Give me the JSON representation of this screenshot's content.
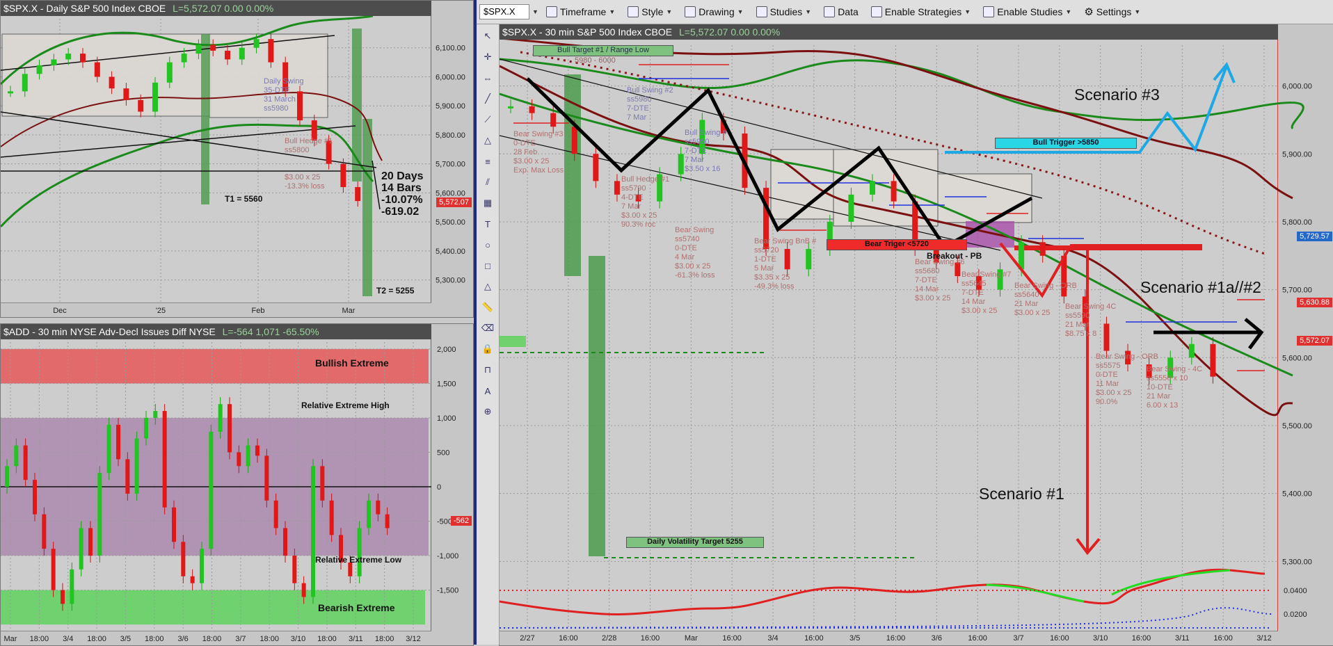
{
  "toolbar": {
    "symbol": "$SPX.X",
    "items": [
      "Timeframe",
      "Style",
      "Drawing",
      "Studies",
      "Data",
      "Enable Strategies",
      "Enable Studies",
      "Settings"
    ]
  },
  "daily": {
    "title": "$SPX.X - Daily  S&P 500 Index  CBOE",
    "last": "L=5,572.07  0.00  0.00%",
    "price_tag": "5,572.07",
    "stats": [
      "20 Days",
      "14 Bars",
      "-10.07%",
      "-619.02"
    ],
    "t1": "T1 = 5560",
    "t2": "T2 = 5255",
    "notes": {
      "daily_swing": [
        "Daily Swing",
        "35-DTE",
        "31 March",
        "ss5980"
      ],
      "bull_hedge": [
        "Bull Hedge #1",
        "ss5800"
      ],
      "bull_hedge_detail": [
        "$3.00 x 25",
        "-13.3% loss"
      ]
    }
  },
  "add": {
    "title": "$ADD - 30 min  NYSE Adv-Decl Issues Diff  NYSE",
    "last": "L=-564  1,071  -65.50%",
    "price_tag": "-562",
    "bands": {
      "bullish": "Bullish Extreme",
      "rel_high": "Relative Extreme High",
      "rel_low": "Relative Extreme Low",
      "bearish": "Bearish Extreme"
    }
  },
  "intraday": {
    "title": "$SPX.X - 30 min  S&P 500 Index  CBOE",
    "last": "L=5,572.07  0.00  0.00%",
    "price_tags": {
      "a": "5,729.57",
      "b": "5,630.88",
      "c": "5,572.07"
    },
    "labels": {
      "bull_target": "Bull Target #1 / Range Low",
      "bull_target_sub": "5980 - 6000",
      "bull_trigger": "Bull Trigger >5850",
      "bear_trigger": "Bear Triger <5720",
      "breakout_pb": "Breakout - PB",
      "daily_vol": "Daily Volatility Target 5255",
      "scenario3": "Scenario #3",
      "scenario1": "Scenario #1",
      "scenario1a": "Scenario #1a//#2"
    },
    "notes": {
      "bear_swing_3": [
        "Bear Swing #3",
        "0-DTE",
        "28 Feb",
        "$3.00 x 25",
        "Exp. Max Loss"
      ],
      "bull_hedge": [
        "Bull Hedge #1",
        "ss5790",
        "4-DTE",
        "7 Mar",
        "$3.00 x 25",
        "90.3% roc"
      ],
      "bull_swing_2": [
        "Bull Swing #2",
        "ss5980",
        "7-DTE",
        "7 Mar"
      ],
      "bull_swing_b": [
        "Bull Swing #",
        "ss5950",
        "7-DTE",
        "7 Mar",
        "$3.50 x 16"
      ],
      "bear_swing_mid": [
        "Bear Swing",
        "ss5740",
        "0-DTE",
        "4 Mar",
        "$3.00 x 25",
        "-61.3% loss"
      ],
      "bear_swing_bnb": [
        "Bear Swing BnB #",
        "ss5720",
        "1-DTE",
        "5 Mar",
        "$3.35 x 25",
        "-49.3% loss"
      ],
      "bear_swing_6": [
        "Bear Swing #6",
        "ss5680",
        "7-DTE",
        "14 Mar",
        "$3.00 x 25"
      ],
      "bear_swing_7": [
        "Bear Swing #7",
        "ss5645",
        "7-DTE",
        "14 Mar",
        "$3.00 x 25"
      ],
      "bear_swing_orb1": [
        "Bear Swing - ORB",
        "ss5640",
        "21 Mar",
        "$3.00 x 25"
      ],
      "bear_swing_4c": [
        "Bear Swing 4C",
        "ss5590",
        "21 Mar",
        "$8.75 x 8"
      ],
      "bear_swing_orb2": [
        "Bear Swing - ORB",
        "ss5575",
        "0-DTE",
        "11 Mar",
        "$3.00 x 25",
        "90.0%"
      ],
      "bear_swing_4c2": [
        "Bear Swing - 4C",
        "ss5550 x 10",
        "10-DTE",
        "21 Mar",
        "6.00 x 13"
      ]
    }
  },
  "chart_data": [
    {
      "type": "line",
      "title": "$SPX.X - Daily  S&P 500 Index  CBOE",
      "x_ticks": [
        "Dec",
        "'25",
        "Feb",
        "Mar"
      ],
      "y_ticks": [
        5300,
        5400,
        5500,
        5600,
        5700,
        5800,
        5900,
        6000,
        6100
      ],
      "ylim": [
        5220,
        6200
      ],
      "series": [
        {
          "values": [
            5950,
            6010,
            6040,
            6060,
            6080,
            6050,
            6000,
            5960,
            5920,
            5880,
            5980,
            6050,
            6080,
            6110,
            6090,
            6060,
            6100,
            6130,
            6050,
            5950,
            5850,
            5780,
            5700,
            5620,
            5572
          ]
        }
      ]
    },
    {
      "type": "bar",
      "title": "$ADD - 30 min  NYSE Adv-Decl Issues Diff  NYSE",
      "x_ticks": [
        "Mar",
        "18:00",
        "3/4",
        "18:00",
        "3/5",
        "18:00",
        "3/6",
        "18:00",
        "3/7",
        "18:00",
        "3/10",
        "18:00",
        "3/11",
        "18:00",
        "3/12"
      ],
      "y_ticks": [
        -1500,
        -1000,
        -500,
        0,
        500,
        1000,
        1500,
        2000
      ],
      "ylim": [
        -2100,
        2100
      ],
      "values": [
        300,
        600,
        100,
        -400,
        -900,
        -1500,
        -1700,
        -1200,
        -600,
        -1000,
        200,
        900,
        400,
        -100,
        700,
        1000,
        1100,
        -300,
        -800,
        -1300,
        -1400,
        -900,
        800,
        1200,
        500,
        300,
        600,
        450,
        -200,
        -600,
        -1000,
        -1400,
        -1600,
        300,
        -200,
        -700,
        -1100,
        -1300,
        -600,
        -200,
        -400,
        -600
      ]
    },
    {
      "type": "line",
      "title": "$SPX.X - 30 min  S&P 500 Index  CBOE",
      "x_ticks": [
        "2/27",
        "16:00",
        "2/28",
        "16:00",
        "Mar",
        "16:00",
        "3/4",
        "16:00",
        "3/5",
        "16:00",
        "3/6",
        "16:00",
        "3/7",
        "16:00",
        "3/10",
        "16:00",
        "3/11",
        "16:00",
        "3/12"
      ],
      "y_ticks": [
        5300,
        5400,
        5500,
        5600,
        5700,
        5800,
        5900,
        6000
      ],
      "ylim": [
        5200,
        6060
      ],
      "series": [
        {
          "values": [
            5970,
            5960,
            5940,
            5900,
            5860,
            5840,
            5830,
            5870,
            5900,
            5950,
            5930,
            5850,
            5760,
            5730,
            5760,
            5800,
            5840,
            5860,
            5830,
            5760,
            5740,
            5720,
            5700,
            5730,
            5770,
            5750,
            5690,
            5650,
            5610,
            5590,
            5570,
            5600,
            5620,
            5572
          ]
        }
      ]
    }
  ]
}
